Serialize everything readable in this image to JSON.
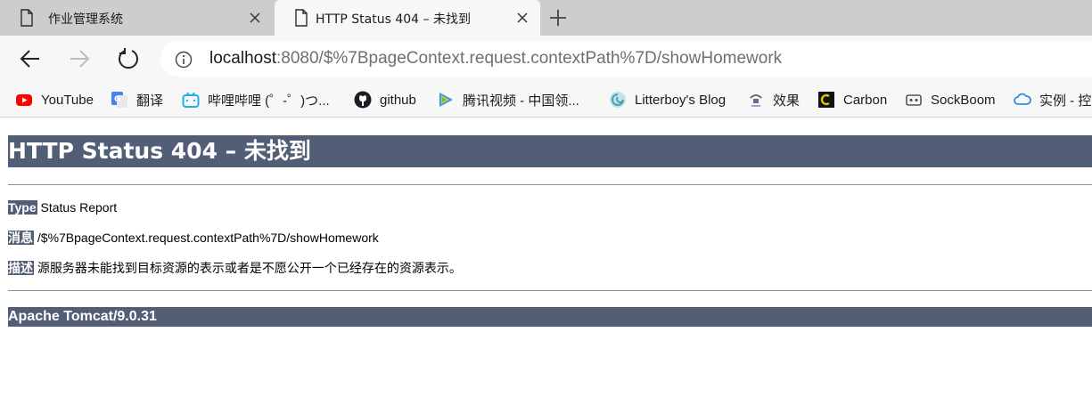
{
  "tabs": [
    {
      "title": "作业管理系统",
      "active": false
    },
    {
      "title": "HTTP Status 404 – 未找到",
      "active": true
    }
  ],
  "toolbar": {
    "url_host": "localhost",
    "url_rest": ":8080/$%7BpageContext.request.contextPath%7D/showHomework"
  },
  "bookmarks": [
    {
      "label": "YouTube",
      "icon": "youtube-icon"
    },
    {
      "label": "翻译",
      "icon": "google-translate-icon"
    },
    {
      "label": "哔哩哔哩 (゜-゜)つ...",
      "icon": "bilibili-icon"
    },
    {
      "label": "github",
      "icon": "github-icon"
    },
    {
      "label": "腾讯视频 - 中国领...",
      "icon": "tencent-video-icon"
    },
    {
      "label": "Litterboy's Blog",
      "icon": "blog-icon"
    },
    {
      "label": "效果",
      "icon": "effect-icon"
    },
    {
      "label": "Carbon",
      "icon": "carbon-icon"
    },
    {
      "label": "SockBoom",
      "icon": "sockboom-icon"
    },
    {
      "label": "实例 - 控",
      "icon": "cloud-icon"
    }
  ],
  "page": {
    "title": "HTTP Status 404 – 未找到",
    "type_label": "Type",
    "type_value": "Status Report",
    "message_label": "消息",
    "message_value": "/$%7BpageContext.request.contextPath%7D/showHomework",
    "description_label": "描述",
    "description_value": "源服务器未能找到目标资源的表示或者是不愿公开一个已经存在的资源表示。",
    "footer": "Apache Tomcat/9.0.31"
  },
  "colors": {
    "tomcat_header_bg": "#525d76",
    "tab_strip_bg": "#cdcdcd",
    "toolbar_bg": "#f7f7f7"
  }
}
